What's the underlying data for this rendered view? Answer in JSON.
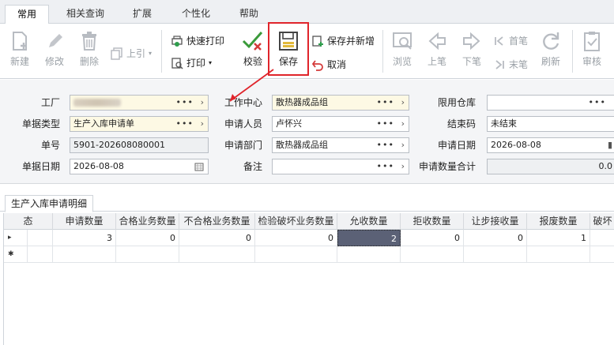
{
  "ribbon_tabs": [
    {
      "label": "常用",
      "active": true
    },
    {
      "label": "相关查询",
      "active": false
    },
    {
      "label": "扩展",
      "active": false
    },
    {
      "label": "个性化",
      "active": false
    },
    {
      "label": "帮助",
      "active": false
    }
  ],
  "toolbar": {
    "new": "新建",
    "edit": "修改",
    "delete": "删除",
    "prev_ref": "上引",
    "quick_print": "快速打印",
    "print": "打印",
    "check": "校验",
    "save": "保存",
    "save_and_new": "保存并新增",
    "cancel": "取消",
    "browse": "浏览",
    "prev_record": "上笔",
    "next_record": "下笔",
    "first_record": "首笔",
    "last_record": "末笔",
    "refresh": "刷新",
    "audit": "审核"
  },
  "form": {
    "factory_label": "工厂",
    "doc_type_label": "单据类型",
    "doc_type_value": "生产入库申请单",
    "doc_no_label": "单号",
    "doc_no_value": "5901-202608080001",
    "doc_date_label": "单据日期",
    "doc_date_value": "2026-08-08",
    "work_center_label": "工作中心",
    "work_center_value": "散热器成品组",
    "applicant_label": "申请人员",
    "applicant_value": "卢怀兴",
    "apply_dept_label": "申请部门",
    "apply_dept_value": "散热器成品组",
    "remark_label": "备注",
    "remark_value": "",
    "limit_warehouse_label": "限用仓库",
    "limit_warehouse_value": "",
    "close_code_label": "结束码",
    "close_code_value": "未结束",
    "apply_date_label": "申请日期",
    "apply_date_value": "2026-08-08",
    "apply_qty_total_label": "申请数量合计",
    "apply_qty_total_value": "0.0"
  },
  "detail": {
    "tab_label": "生产入库申请明细",
    "columns": [
      "态",
      "申请数量",
      "合格业务数量",
      "不合格业务数量",
      "检验破坏业务数量",
      "允收数量",
      "拒收数量",
      "让步接收量",
      "报废数量",
      "破坏"
    ],
    "rows": [
      {
        "indicator": "▸",
        "cells": [
          "",
          "3",
          "0",
          "0",
          "0",
          "2",
          "0",
          "0",
          "1",
          ""
        ]
      },
      {
        "indicator": "✱",
        "cells": [
          "",
          "",
          "",
          "",
          "",
          "",
          "",
          "",
          "",
          ""
        ]
      }
    ]
  },
  "colors": {
    "highlight_red": "#e0242b",
    "selected_cell": "#5b6176",
    "yellow_field": "#fdf9e4"
  }
}
